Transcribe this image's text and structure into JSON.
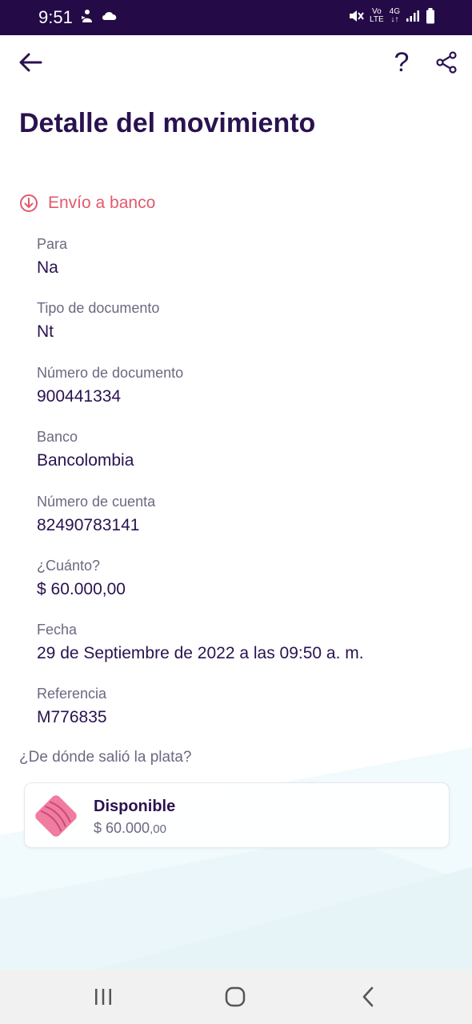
{
  "status_bar": {
    "time": "9:51",
    "left_icons": [
      "person-notification-icon",
      "cloud-icon"
    ],
    "right_icons": [
      "mute-icon",
      "volte-icon",
      "4g-icon",
      "signal-icon",
      "battery-icon"
    ],
    "volte_top": "Vo",
    "volte_bottom": "LTE",
    "net_label": "4G"
  },
  "header": {
    "back_icon": "arrow-left-icon",
    "help_label": "?",
    "share_icon": "share-icon"
  },
  "page_title": "Detalle del movimiento",
  "movement_type": {
    "icon": "arrow-down-circle-icon",
    "label": "Envío a banco"
  },
  "fields": [
    {
      "label": "Para",
      "value": "Na"
    },
    {
      "label": "Tipo de documento",
      "value": "Nt"
    },
    {
      "label": "Número de documento",
      "value": "900441334"
    },
    {
      "label": "Banco",
      "value": "Bancolombia"
    },
    {
      "label": "Número de cuenta",
      "value": "82490783141"
    },
    {
      "label": "¿Cuánto?",
      "value": "$ 60.000,00"
    },
    {
      "label": "Fecha",
      "value": "29 de Septiembre de 2022 a las 09:50 a. m."
    },
    {
      "label": "Referencia",
      "value": "M776835"
    }
  ],
  "origin": {
    "question": "¿De dónde salió la plata?",
    "account": {
      "icon": "pink-wallet-icon",
      "name": "Disponible",
      "amount_main": "$ 60.000",
      "amount_decimals": ",00"
    }
  },
  "nav_bar": [
    "recent-apps-icon",
    "home-icon",
    "back-icon"
  ],
  "colors": {
    "status_bar": "#240a46",
    "title": "#2a1250",
    "accent": "#e05a6d",
    "label": "#6d6880",
    "nav_bar": "#f1f1f1"
  }
}
